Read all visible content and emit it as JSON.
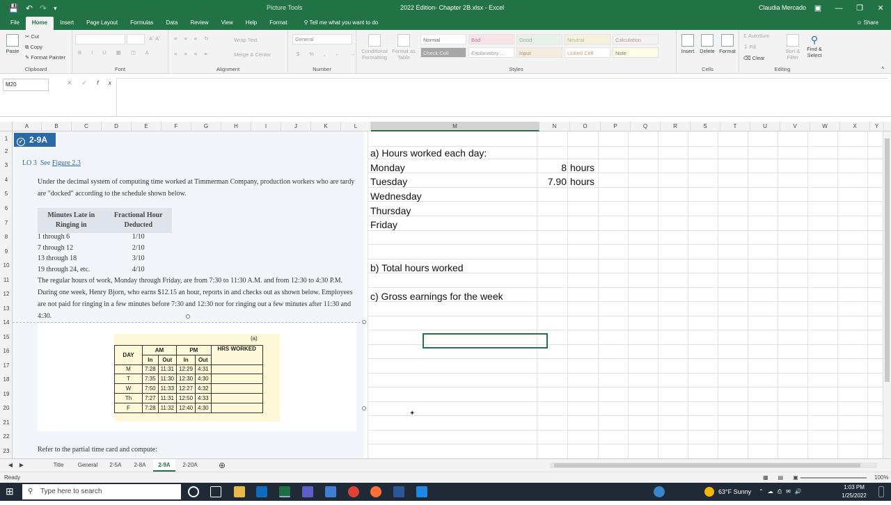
{
  "titlebar": {
    "context_tab": "Picture Tools",
    "document": "2022 Edition- Chapter 2B.xlsx - Excel",
    "user": "Claudia Mercado"
  },
  "tabs": [
    "File",
    "Home",
    "Insert",
    "Page Layout",
    "Formulas",
    "Data",
    "Review",
    "View",
    "Help",
    "Format"
  ],
  "tellme": "Tell me what you want to do",
  "share": "Share",
  "ribbon": {
    "clipboard": {
      "paste": "Paste",
      "cut": "Cut",
      "copy": "Copy",
      "format_painter": "Format Painter",
      "label": "Clipboard"
    },
    "font": {
      "label": "Font"
    },
    "alignment": {
      "wrap": "Wrap Text",
      "merge": "Merge & Center",
      "label": "Alignment"
    },
    "number": {
      "format": "General",
      "label": "Number"
    },
    "styles": {
      "conditional": "Conditional Formatting",
      "format_as_table": "Format as Table",
      "cells": [
        [
          "Normal",
          "Bad",
          "Good",
          "Neutral",
          "Calculation"
        ],
        [
          "Check Cell",
          "Explanatory ...",
          "Input",
          "Linked Cell",
          "Note"
        ]
      ],
      "label": "Styles"
    },
    "cells": {
      "insert": "Insert",
      "delete": "Delete",
      "format": "Format",
      "label": "Cells"
    },
    "editing": {
      "autosum": "AutoSum",
      "fill": "Fill",
      "clear": "Clear",
      "sort": "Sort & Filter",
      "find": "Find & Select",
      "label": "Editing"
    }
  },
  "formula_bar": {
    "namebox": "M20",
    "fx": "fx",
    "content": ""
  },
  "columns": [
    "A",
    "B",
    "C",
    "D",
    "E",
    "F",
    "G",
    "H",
    "I",
    "J",
    "K",
    "L",
    "M",
    "N",
    "O",
    "P",
    "Q",
    "R",
    "S",
    "T",
    "U",
    "V",
    "W",
    "X",
    "Y"
  ],
  "rows": [
    "1",
    "2",
    "3",
    "4",
    "5",
    "6",
    "7",
    "8",
    "9",
    "10",
    "11",
    "12",
    "13",
    "14",
    "15",
    "16",
    "17",
    "18",
    "19",
    "20",
    "21",
    "22",
    "23"
  ],
  "picture": {
    "badge": "2-9A",
    "lo": "LO 3",
    "see": "See",
    "figure": "Figure 2.3",
    "intro": "Under the decimal system of computing time worked at Timmerman Company, production workers who are tardy are \"docked\" according to the schedule shown below.",
    "schedule_headers": [
      "Minutes Late in Ringing in",
      "Fractional Hour Deducted"
    ],
    "schedule_rows": [
      [
        "1 through 6",
        "1/10"
      ],
      [
        "7 through 12",
        "2/10"
      ],
      [
        "13 through 18",
        "3/10"
      ],
      [
        "19 through 24, etc.",
        "4/10"
      ]
    ],
    "body": "The regular hours of work, Monday through Friday, are from 7:30 to 11:30 A.M. and from 12:30 to 4:30 P.M. During one week, Henry Bjorn, who earns $12.15 an hour, reports in and checks out as shown below. Employees are not paid for ringing in a few minutes before 7:30 and 12:30 nor for ringing out a few minutes after 11:30 and 4:30.",
    "card_label": "(a)",
    "card_headers": [
      "DAY",
      "AM",
      "PM",
      "HRS WORKED"
    ],
    "card_sub": [
      "In",
      "Out",
      "In",
      "Out"
    ],
    "card_rows": [
      [
        "M",
        "7:28",
        "11:31",
        "12:29",
        "4:31"
      ],
      [
        "T",
        "7:35",
        "11:30",
        "12:30",
        "4:30"
      ],
      [
        "W",
        "7:50",
        "11:33",
        "12:27",
        "4:32"
      ],
      [
        "Th",
        "7:27",
        "11:31",
        "12:50",
        "4:33"
      ],
      [
        "F",
        "7:28",
        "11:32",
        "12:40",
        "4:30"
      ]
    ],
    "refer": "Refer to the partial time card and compute:"
  },
  "cells": {
    "a_title": "a) Hours worked each day:",
    "days": [
      "Monday",
      "Tuesday",
      "Wednesday",
      "Thursday",
      "Friday"
    ],
    "hours": [
      "8",
      "7.90",
      "",
      "",
      ""
    ],
    "units": [
      "hours",
      "hours",
      "",
      "",
      ""
    ],
    "b_title": "b) Total hours worked",
    "c_title": "c) Gross earnings for the week"
  },
  "sheet_tabs": [
    "Title",
    "General",
    "2-5A",
    "2-8A",
    "2-9A",
    "2-20A"
  ],
  "active_sheet": "2-9A",
  "status": "Ready",
  "zoom": "100%",
  "taskbar": {
    "search": "Type here to search",
    "weather": "63°F  Sunny",
    "time": "1:03 PM",
    "date": "1/25/2022"
  }
}
